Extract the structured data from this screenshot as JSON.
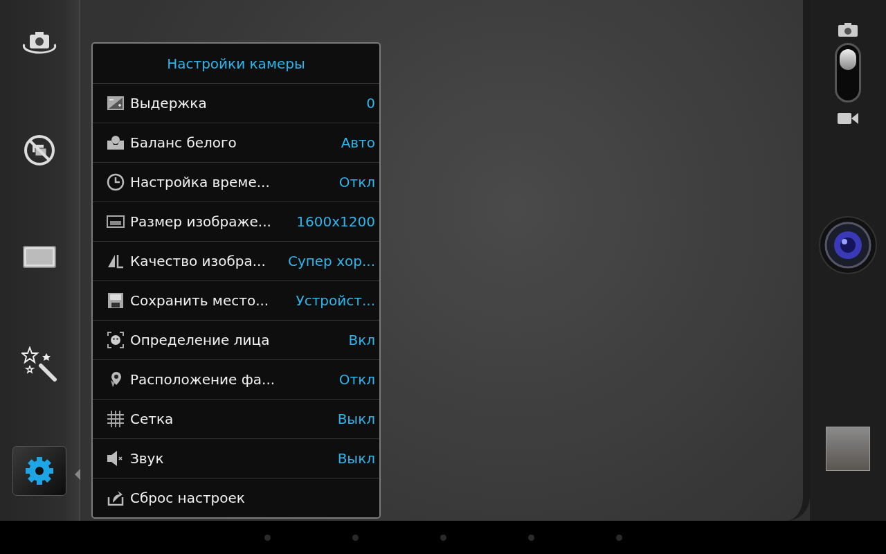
{
  "sidebar": {
    "items": [
      {
        "selected": false
      },
      {
        "selected": false
      },
      {
        "selected": false
      },
      {
        "selected": false
      },
      {
        "selected": true
      }
    ]
  },
  "settings_menu": {
    "title": "Настройки камеры",
    "rows": [
      {
        "label": "Выдержка",
        "value": "0"
      },
      {
        "label": "Баланс белого",
        "value": "Авто"
      },
      {
        "label": "Настройка време...",
        "value": "Откл"
      },
      {
        "label": "Размер изображе...",
        "value": "1600x1200"
      },
      {
        "label": "Качество изобра...",
        "value": "Супер хор..."
      },
      {
        "label": "Сохранить место...",
        "value": "Устройст..."
      },
      {
        "label": "Определение лица",
        "value": "Вкл"
      },
      {
        "label": "Расположение фа...",
        "value": "Откл"
      },
      {
        "label": "Сетка",
        "value": "Выкл"
      },
      {
        "label": "Звук",
        "value": "Выкл"
      },
      {
        "label": "Сброс настроек"
      }
    ]
  },
  "capture_panel": {
    "video_mode": false
  }
}
